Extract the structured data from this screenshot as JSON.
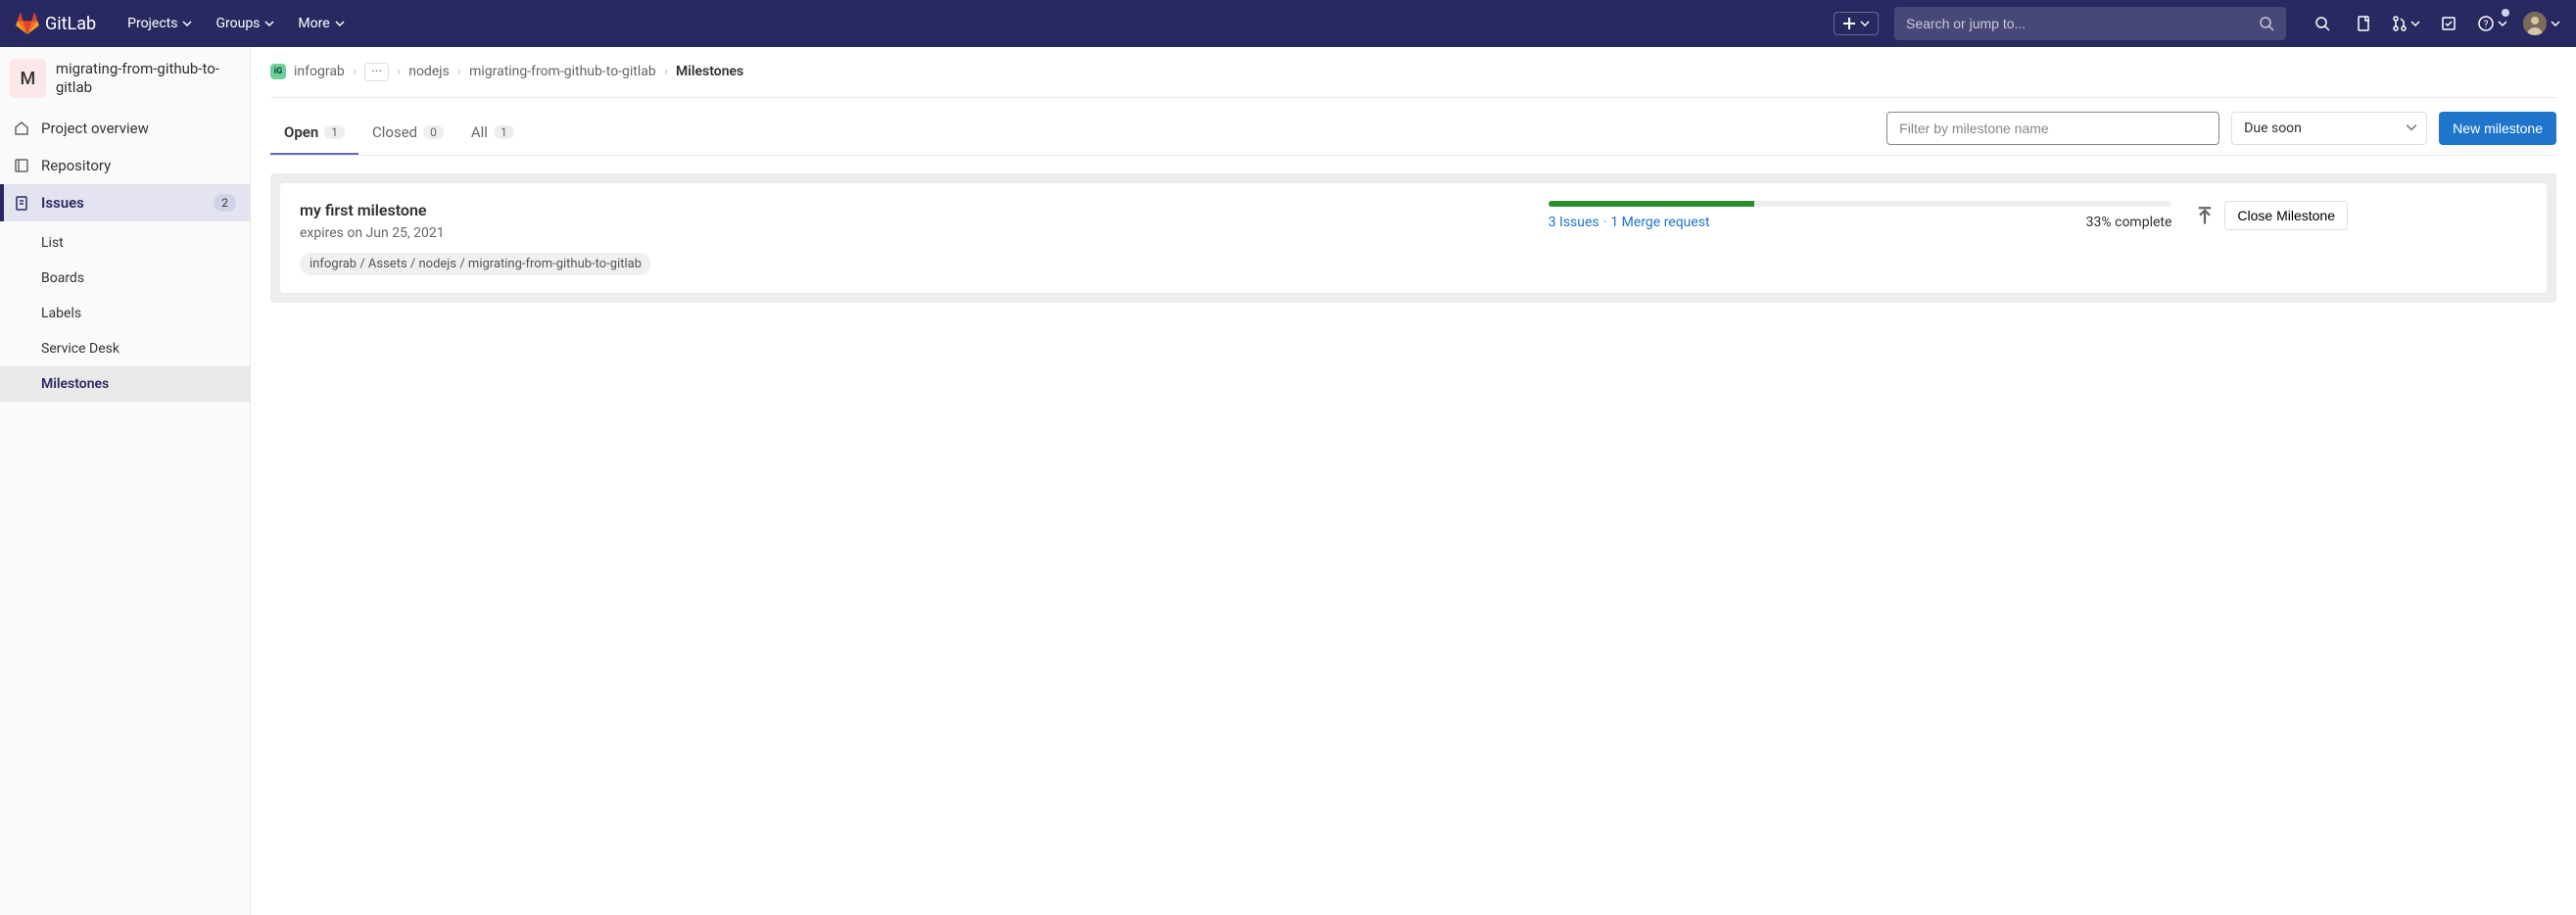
{
  "topnav": {
    "brand": "GitLab",
    "items": {
      "projects": "Projects",
      "groups": "Groups",
      "more": "More"
    },
    "search_placeholder": "Search or jump to..."
  },
  "sidebar": {
    "project_initial": "M",
    "project_name": "migrating-from-github-to-gitlab",
    "overview": "Project overview",
    "repository": "Repository",
    "issues": {
      "label": "Issues",
      "count": "2"
    },
    "sub": {
      "list": "List",
      "boards": "Boards",
      "labels": "Labels",
      "service_desk": "Service Desk",
      "milestones": "Milestones"
    }
  },
  "breadcrumb": {
    "group_initial": "iG",
    "group": "infograb",
    "nodejs": "nodejs",
    "project": "migrating-from-github-to-gitlab",
    "current": "Milestones"
  },
  "tabs": {
    "open": {
      "label": "Open",
      "count": "1"
    },
    "closed": {
      "label": "Closed",
      "count": "0"
    },
    "all": {
      "label": "All",
      "count": "1"
    }
  },
  "filter": {
    "placeholder": "Filter by milestone name",
    "sort": "Due soon",
    "new_button": "New milestone"
  },
  "milestone": {
    "title": "my first milestone",
    "expires": "expires on Jun 25, 2021",
    "path": "infograb / Assets / nodejs / migrating-from-github-to-gitlab",
    "issues_link": "3 Issues",
    "mr_link": "1 Merge request",
    "complete": "33% complete",
    "progress_pct": 33,
    "close_button": "Close Milestone"
  }
}
